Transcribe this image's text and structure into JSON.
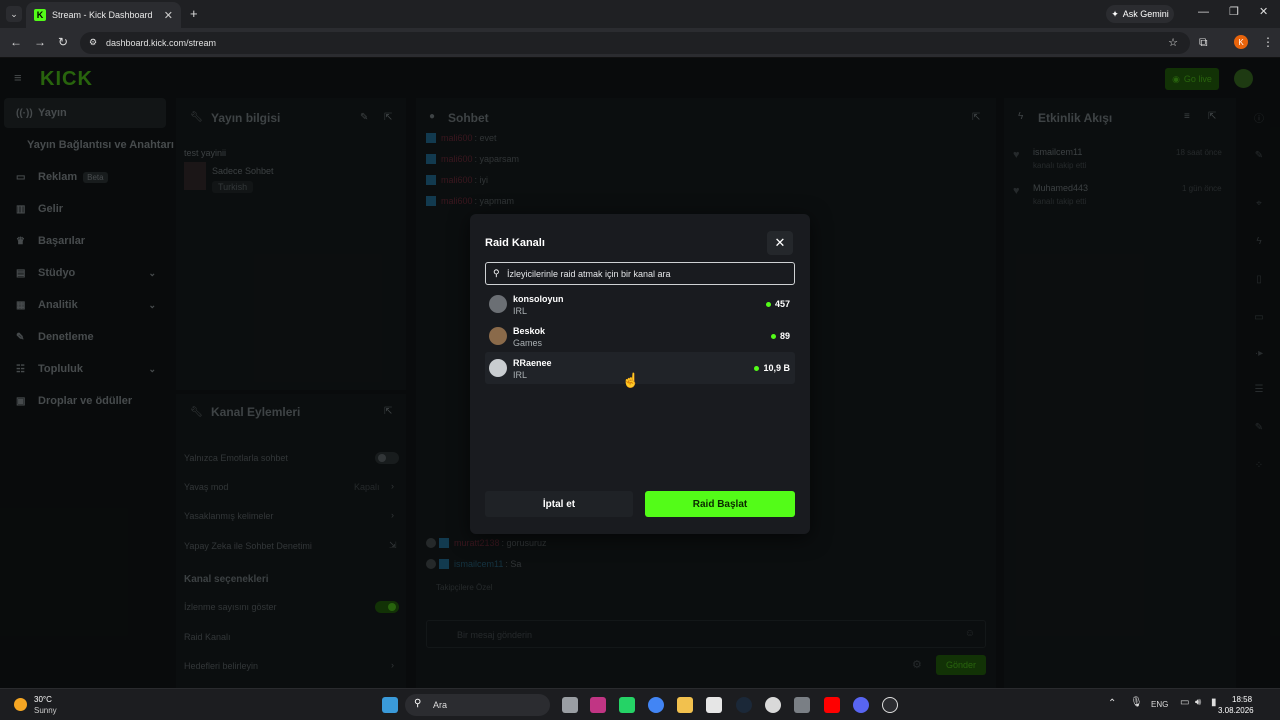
{
  "browser": {
    "tab_title": "Stream - Kick Dashboard",
    "url": "dashboard.kick.com/stream",
    "ask_gemini": "Ask Gemini",
    "profile_initial": "K"
  },
  "dashboard": {
    "logo": "KICK",
    "go_live": "Go live",
    "sidebar": [
      {
        "label": "Yayın",
        "icon": "broadcast-icon"
      },
      {
        "label": "Yayın Bağlantısı ve Anahtarı",
        "icon": ""
      },
      {
        "label": "Reklam",
        "icon": "ad-icon",
        "badge": "Beta"
      },
      {
        "label": "Gelir",
        "icon": "chart-icon"
      },
      {
        "label": "Başarılar",
        "icon": "trophy-icon"
      },
      {
        "label": "Stüdyo",
        "icon": "studio-icon"
      },
      {
        "label": "Analitik",
        "icon": "analytics-icon"
      },
      {
        "label": "Denetleme",
        "icon": "wrench-icon"
      },
      {
        "label": "Topluluk",
        "icon": "community-icon"
      },
      {
        "label": "Droplar ve ödüller",
        "icon": "gift-icon"
      }
    ],
    "stream_info": {
      "title": "Yayın bilgisi",
      "stream_title": "test yayinii",
      "category": "Sadece Sohbet",
      "language": "Turkish"
    },
    "channel_actions": {
      "title": "Kanal Eylemleri",
      "emote_only": "Yalnızca Emotlarla sohbet",
      "slow_mode": "Yavaş mod",
      "slow_mode_value": "Kapalı",
      "banned_words": "Yasaklanmış kelimeler",
      "ai_moderation": "Yapay Zeka ile Sohbet Denetimi",
      "channel_options": "Kanal seçenekleri",
      "show_viewers": "İzlenme sayısını göster",
      "raid_channel": "Raid Kanalı",
      "set_goals": "Hedefleri belirleyin"
    },
    "chat": {
      "title": "Sohbet",
      "messages": [
        {
          "user": "mali600",
          "text": ": evet"
        },
        {
          "user": "mali600",
          "text": ": yaparsam"
        },
        {
          "user": "mali600",
          "text": ": iyi"
        },
        {
          "user": "mali600",
          "text": ": yapmam"
        },
        {
          "user": "muratt2138",
          "text": ": gorusuruz"
        },
        {
          "user": "ismailcem11",
          "text": ": Sa"
        }
      ],
      "followers_only": "Takipçilere Özel",
      "input_placeholder": "Bir mesaj gönderin",
      "send": "Gönder"
    },
    "activity": {
      "title": "Etkinlik Akışı",
      "items": [
        {
          "user": "ismailcem11",
          "action": "kanalı takip etti",
          "time": "18 saat önce"
        },
        {
          "user": "Muhamed443",
          "action": "kanalı takip etti",
          "time": "1 gün önce"
        }
      ]
    }
  },
  "modal": {
    "title": "Raid Kanalı",
    "search_placeholder": "İzleyicilerinle raid atmak için bir kanal ara",
    "channels": [
      {
        "name": "konsoloyun",
        "category": "IRL",
        "viewers": "457"
      },
      {
        "name": "Beskok",
        "category": "Games",
        "viewers": "89"
      },
      {
        "name": "RRaenee",
        "category": "IRL",
        "viewers": "10,9 B"
      }
    ],
    "cancel": "İptal et",
    "start_raid": "Raid Başlat"
  },
  "taskbar": {
    "weather_temp": "30°C",
    "weather_desc": "Sunny",
    "search": "Ara",
    "lang": "ENG",
    "time": "18:58",
    "date": "3.08.2026"
  },
  "colors": {
    "accent": "#53fc18",
    "modal_bg": "#191b1f",
    "page_bg": "#0e1213"
  }
}
